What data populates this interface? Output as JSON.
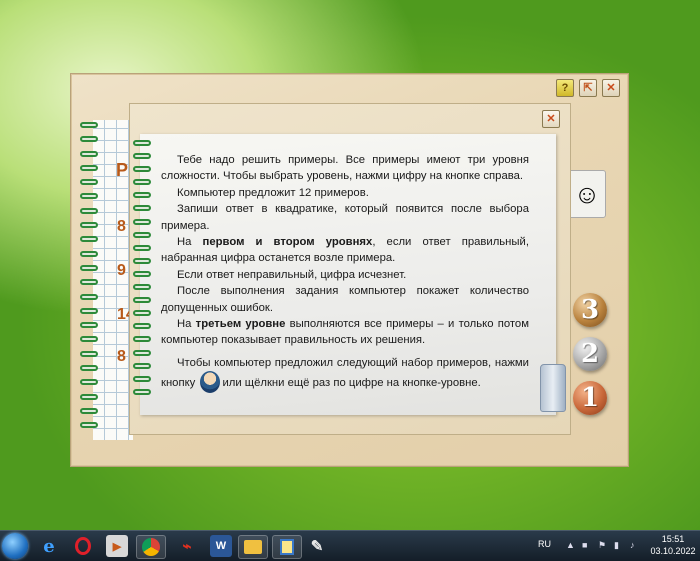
{
  "window": {
    "help_label": "?",
    "minimize_label": "⇱",
    "close_label": "✕",
    "dialog_close_label": "✕"
  },
  "notebook": {
    "numbers": [
      "Р",
      "8",
      "9",
      "14",
      "8"
    ]
  },
  "instructions": {
    "p1": "Тебе надо решить примеры. Все примеры имеют три уровня сложности. Чтобы выбрать уровень, нажми цифру на кнопке справа.",
    "p2": "Компьютер предложит 12 примеров.",
    "p3": "Запиши ответ в квадратике, который появится после выбора примера.",
    "p4_pre": "На ",
    "p4_bold": "первом и втором уровнях",
    "p4_post": ", если ответ правильный, набранная цифра останется возле примера.",
    "p5": "Если ответ неправильный, цифра исчезнет.",
    "p6": "После выполнения задания компьютер покажет количество допущенных ошибок.",
    "p7_pre": "На ",
    "p7_bold": "третьем уровне",
    "p7_post": " выполняются все примеры – и только потом компьютер показывает правильность их решения.",
    "p8_a": "Чтобы компьютер предложил следующий набор примеров, нажми кнопку ",
    "p8_b": "или щёлкни ещё раз по цифре на кнопке-уровне."
  },
  "levels": [
    "3",
    "2",
    "1"
  ],
  "level_colors": {
    "3": "#b9823d",
    "2": "#a9a9a9",
    "1": "#c9683a"
  },
  "taskbar": {
    "icons": [
      "windows-start",
      "internet-explorer",
      "opera",
      "media-player",
      "chrome",
      "pdf-reader",
      "word",
      "file-explorer",
      "app-window",
      "paint"
    ],
    "language": "RU",
    "time": "15:51",
    "date": "03.10.2022"
  }
}
